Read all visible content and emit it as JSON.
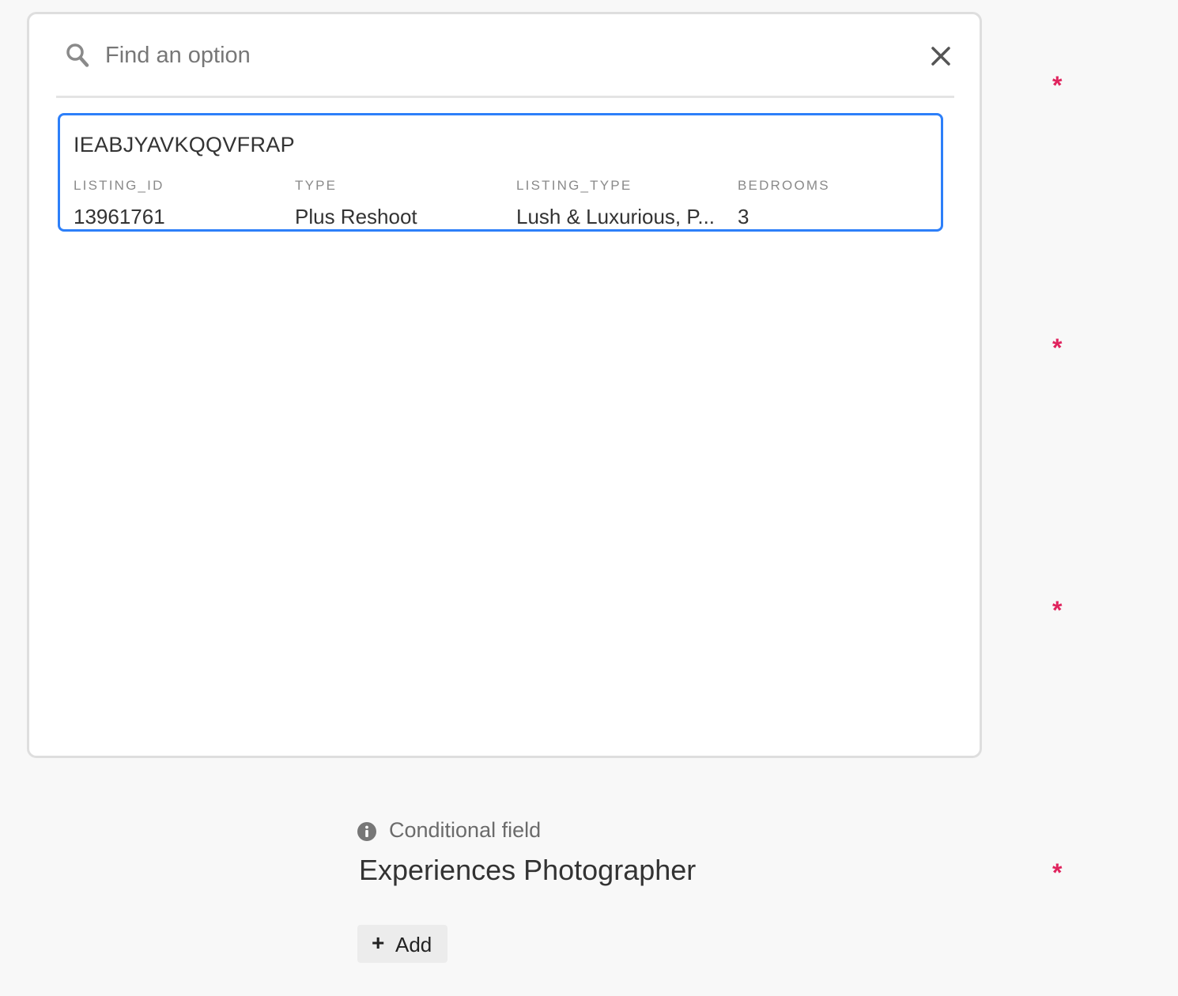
{
  "search": {
    "placeholder": "Find an option",
    "value": ""
  },
  "option": {
    "title": "IEABJYAVKQQVFRAP",
    "fields": [
      {
        "label": "LISTING_ID",
        "value": "13961761"
      },
      {
        "label": "TYPE",
        "value": "Plus Reshoot"
      },
      {
        "label": "LISTING_TYPE",
        "value": "Lush & Luxurious, P..."
      },
      {
        "label": "BEDROOMS",
        "value": "3"
      }
    ]
  },
  "required_marker": "*",
  "conditional": {
    "note": "Conditional field",
    "field_title": "Experiences Photographer",
    "add_plus": "+",
    "add_label": "Add"
  },
  "colors": {
    "accent": "#2d7ff9",
    "required": "#e0245e",
    "panel_border": "#dedede",
    "background": "#f8f8f8"
  },
  "icons": {
    "search": "search-icon",
    "close": "close-icon",
    "info": "info-icon"
  }
}
